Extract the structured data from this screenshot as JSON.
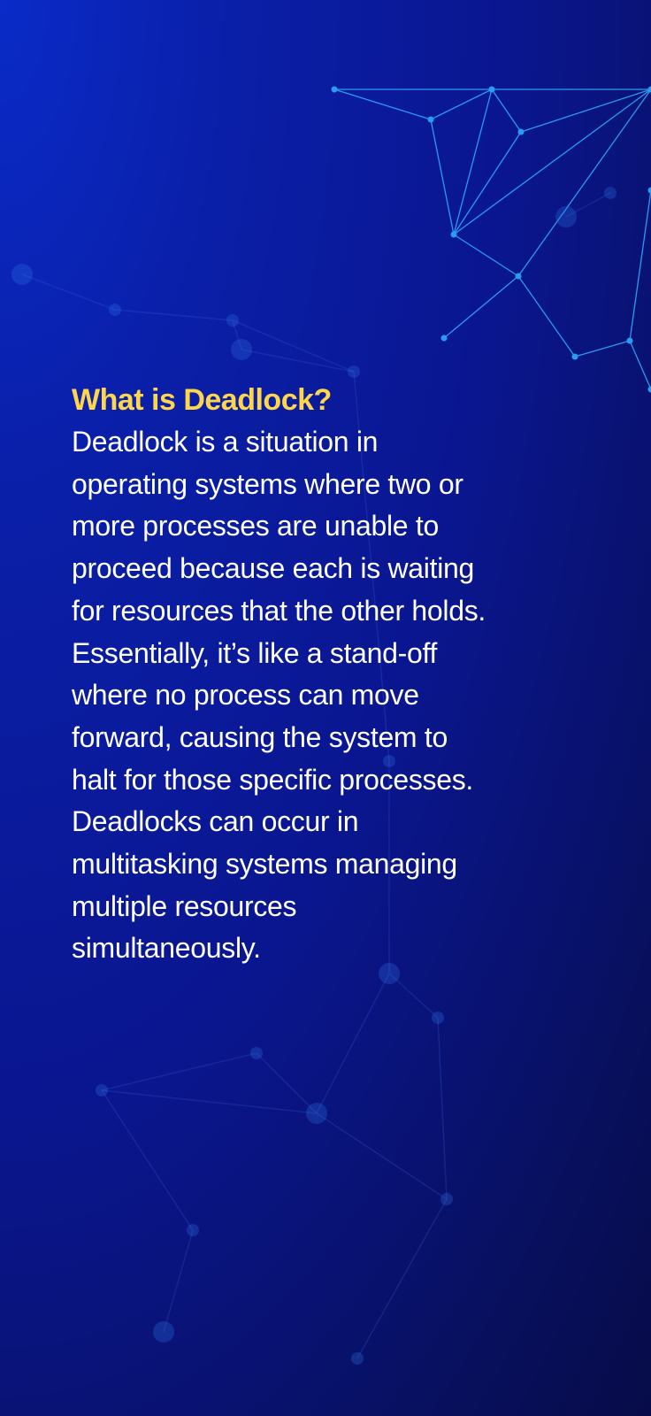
{
  "heading": "What is Deadlock?",
  "body_lines": [
    "Deadlock is a situation in",
    "operating systems where two or",
    "more processes are unable to",
    "proceed because each is waiting",
    "for resources that the other holds.",
    "Essentially, it’s like a stand-off",
    "where no process can move",
    "forward, causing the system to",
    "halt for those specific processes.",
    "Deadlocks can occur in",
    "multitasking systems managing",
    "multiple resources",
    "simultaneously."
  ],
  "colors": {
    "heading": "#fdd64b",
    "text": "#ffffff",
    "network": "#2a9bf0"
  }
}
